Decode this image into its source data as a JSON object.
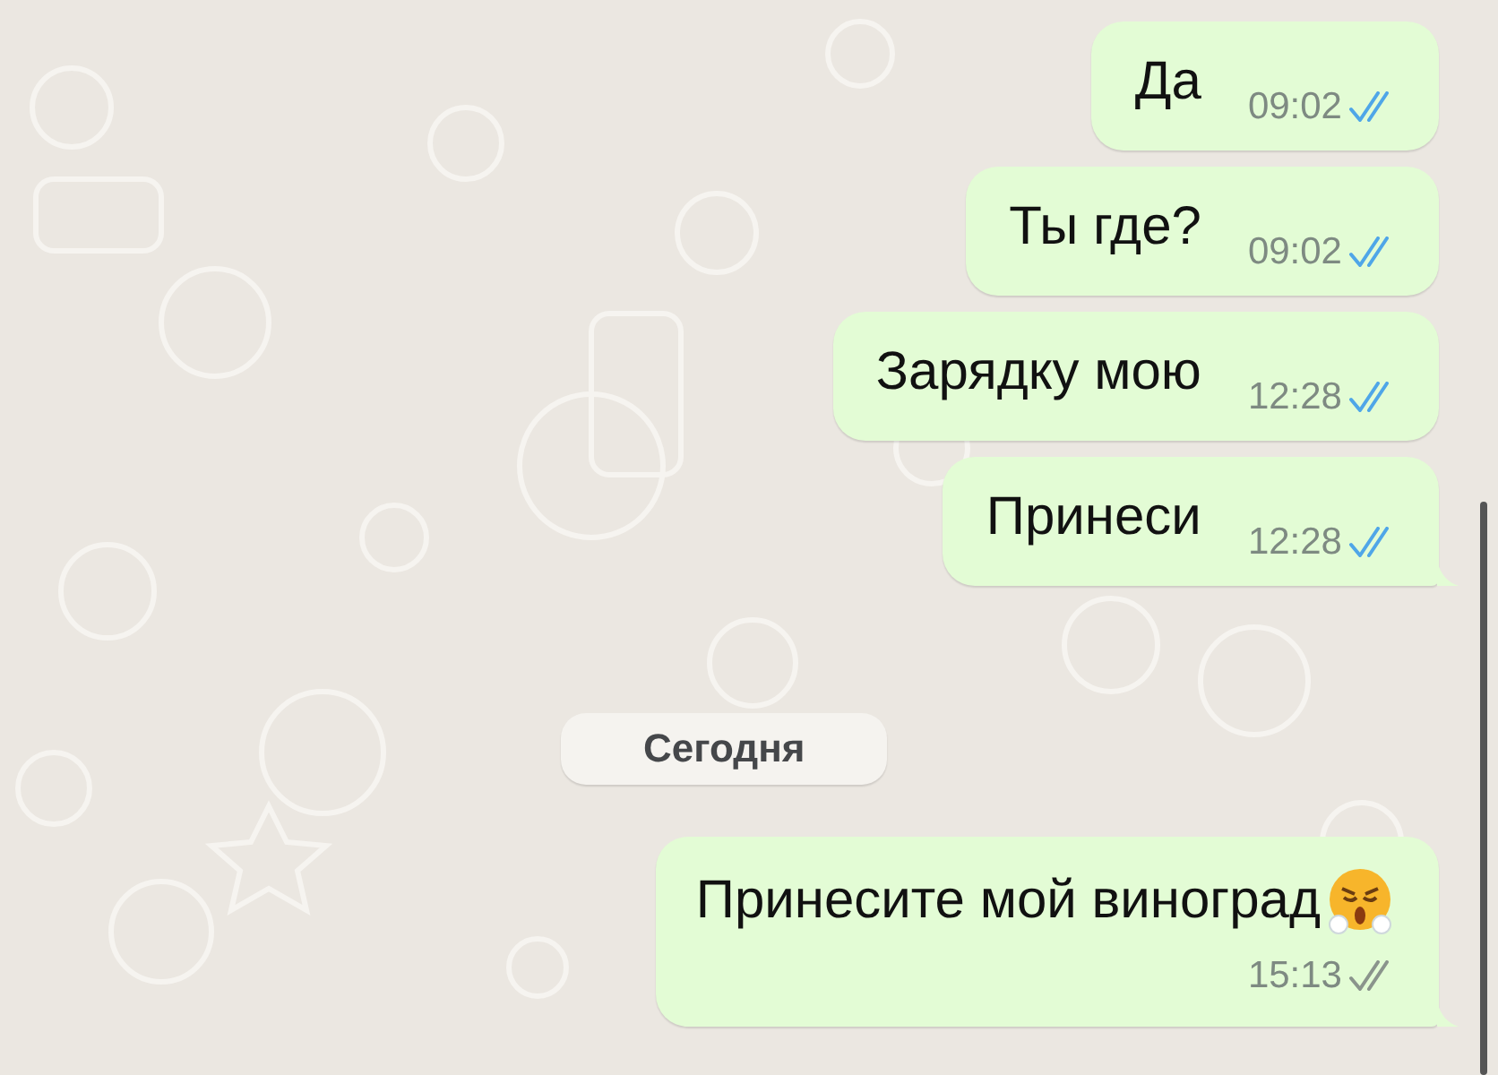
{
  "messages": [
    {
      "kind": "message",
      "text": "Да",
      "time": "09:02",
      "read": true,
      "tail": false
    },
    {
      "kind": "message",
      "text": "Ты где?",
      "time": "09:02",
      "read": true,
      "tail": false
    },
    {
      "kind": "message",
      "text": "Зарядку мою",
      "time": "12:28",
      "read": true,
      "tail": false
    },
    {
      "kind": "message",
      "text": "Принеси",
      "time": "12:28",
      "read": true,
      "tail": true
    },
    {
      "kind": "date",
      "text": "Сегодня"
    },
    {
      "kind": "message",
      "text": "Принесите мой виноград",
      "emoji": true,
      "time": "15:13",
      "read": false,
      "tail": true,
      "multiline": true
    }
  ]
}
